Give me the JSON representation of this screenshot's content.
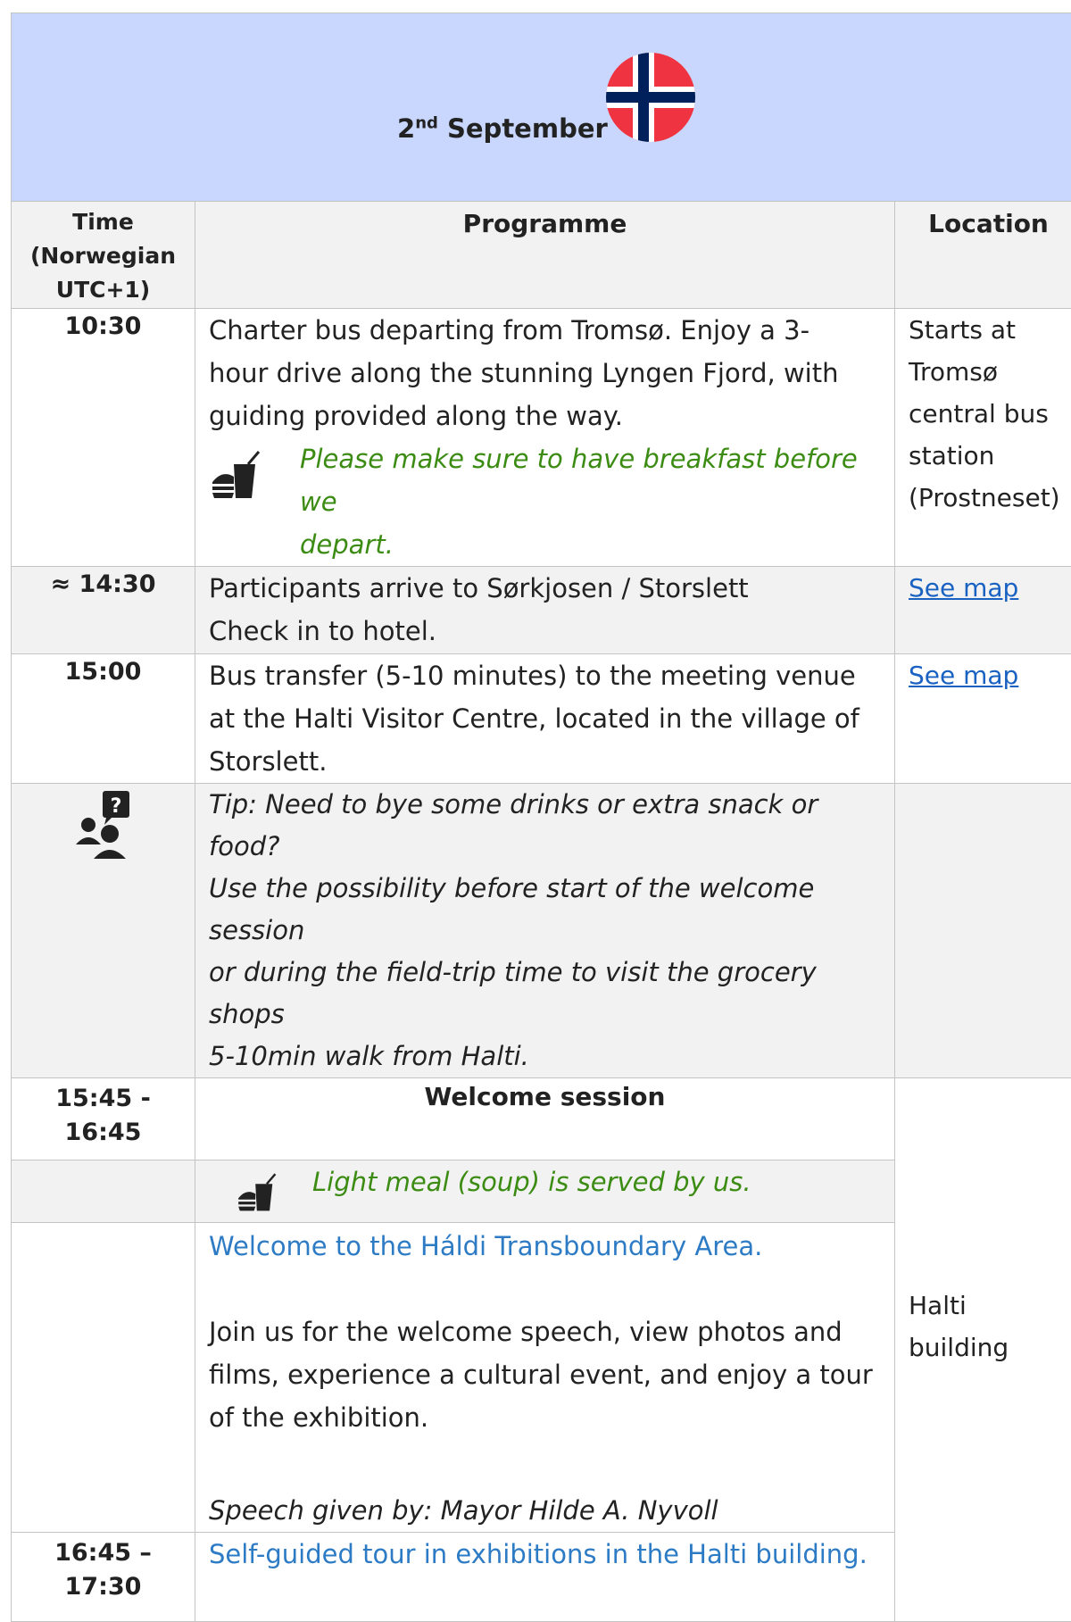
{
  "header": {
    "day": "2",
    "suffix": "nd",
    "month": "September"
  },
  "columns": {
    "time": [
      "Time",
      "(Norwegian",
      "UTC+1)"
    ],
    "programme": "Programme",
    "location": "Location"
  },
  "rows": {
    "r1": {
      "time": "10:30",
      "lines": [
        "Charter bus departing from Tromsø. Enjoy a 3-",
        "hour drive along the stunning Lyngen Fjord, with",
        "guiding provided along the way."
      ],
      "note": [
        "Please make sure to have breakfast before we",
        "depart."
      ],
      "location": [
        "Starts at",
        "Tromsø",
        "central bus",
        "station",
        "(Prostneset)"
      ]
    },
    "r2": {
      "time": "≈ 14:30",
      "lines": [
        "Participants arrive to Sørkjosen / Storslett",
        "Check in to hotel."
      ],
      "location": "See map"
    },
    "r3": {
      "time": "15:00",
      "lines": [
        "Bus transfer (5-10 minutes) to the meeting venue",
        "at the Halti Visitor Centre, located in the village of",
        "Storslett."
      ],
      "location": "See map"
    },
    "r4": {
      "tip": [
        "Tip: Need to bye some drinks or extra snack or food?",
        "Use the possibility before start of the welcome session",
        "or during the field-trip time to visit the grocery shops",
        "5-10min walk from Halti."
      ]
    },
    "r5": {
      "time": [
        "15:45 -",
        "16:45"
      ],
      "title": "Welcome session",
      "meal": "Light meal (soup) is served by us.",
      "welcome": "Welcome to the Háldi Transboundary Area.",
      "body": [
        "Join us for the welcome speech, view photos and",
        "films, experience a cultural event, and enjoy a tour",
        "of the exhibition."
      ],
      "speech": "Speech given by: Mayor Hilde A. Nyvoll",
      "location": [
        "Halti",
        "building"
      ]
    },
    "r6": {
      "time": [
        "16:45 –",
        "17:30"
      ],
      "text": "Self-guided tour in exhibitions in the Halti building."
    }
  },
  "colors": {
    "header_bg": "#c9d7ff",
    "note_green": "#3c8c14",
    "accent_blue": "#2d7bc4",
    "link_blue": "#1a62c2",
    "row_grey": "#f2f2f2"
  },
  "icons": {
    "flag": "norway-flag-icon",
    "food": "food-drink-icon",
    "help": "people-question-icon"
  }
}
